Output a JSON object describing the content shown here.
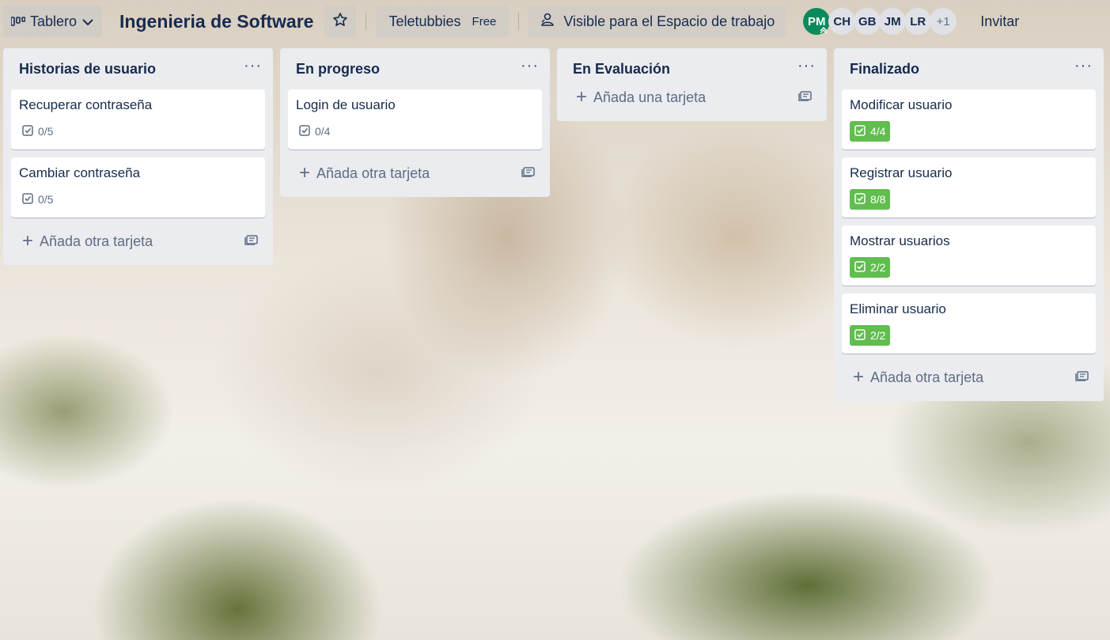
{
  "topbar": {
    "view_label": "Tablero",
    "board_title": "Ingenieria de Software",
    "workspace_name": "Teletubbies",
    "workspace_plan": "Free",
    "visibility_label": "Visible para el Espacio de trabajo",
    "members": [
      "PM",
      "CH",
      "GB",
      "JM",
      "LR"
    ],
    "more_members": "+1",
    "invite_label": "Invitar"
  },
  "lists": [
    {
      "title": "Historias de usuario",
      "menu": "···",
      "add_label": "Añada otra tarjeta",
      "cards": [
        {
          "title": "Recuperar contraseña",
          "checklist": "0/5",
          "complete": false
        },
        {
          "title": "Cambiar contraseña",
          "checklist": "0/5",
          "complete": false
        }
      ]
    },
    {
      "title": "En progreso",
      "menu": "···",
      "add_label": "Añada otra tarjeta",
      "cards": [
        {
          "title": "Login de usuario",
          "checklist": "0/4",
          "complete": false
        }
      ]
    },
    {
      "title": "En Evaluación",
      "menu": "···",
      "add_label": "Añada una tarjeta",
      "cards": []
    },
    {
      "title": "Finalizado",
      "menu": "···",
      "add_label": "Añada otra tarjeta",
      "cards": [
        {
          "title": "Modificar usuario",
          "checklist": "4/4",
          "complete": true
        },
        {
          "title": "Registrar usuario",
          "checklist": "8/8",
          "complete": true
        },
        {
          "title": "Mostrar usuarios",
          "checklist": "2/2",
          "complete": true
        },
        {
          "title": "Eliminar usuario",
          "checklist": "2/2",
          "complete": true
        }
      ]
    }
  ],
  "colors": {
    "complete_badge": "#61bd4f",
    "list_bg": "#ebecf0",
    "text": "#172b4d",
    "admin_avatar": "#0b8a5b"
  }
}
